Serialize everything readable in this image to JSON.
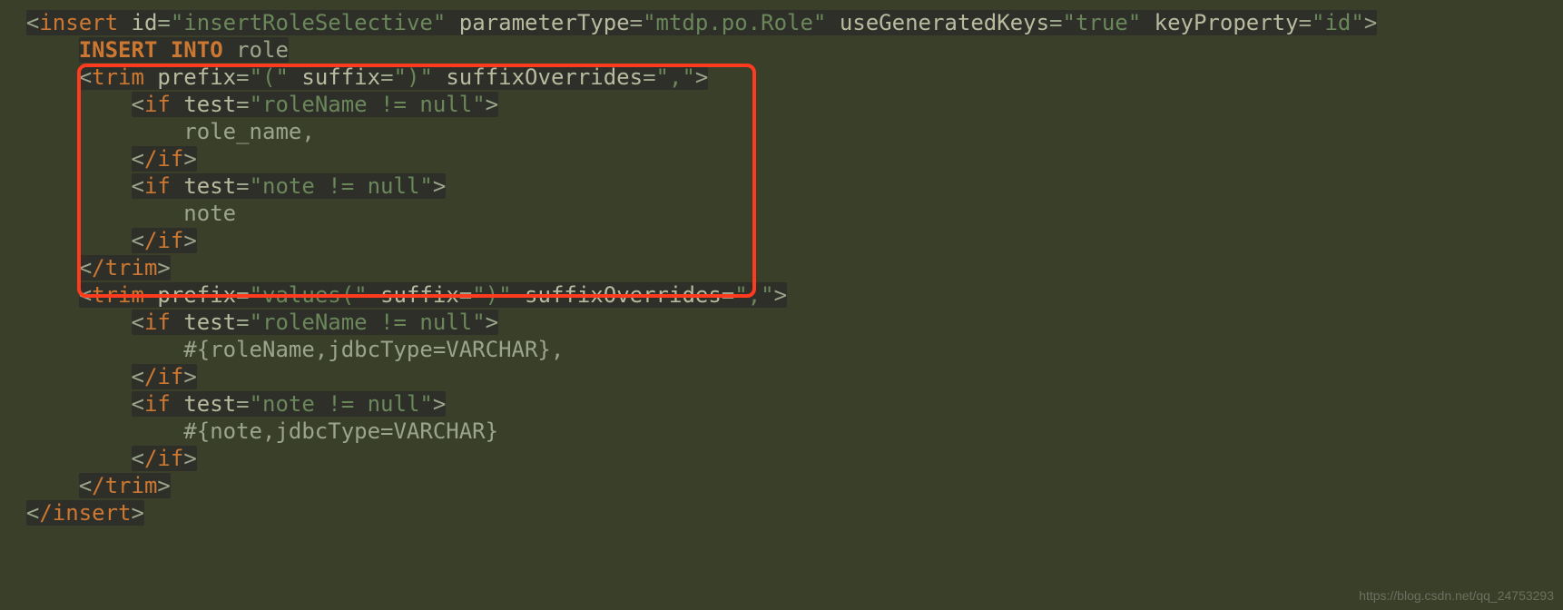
{
  "code": {
    "l1_open_tag": "insert",
    "l1_attr1_name": "id",
    "l1_attr1_val": "insertRoleSelective",
    "l1_attr2_name": "parameterType",
    "l1_attr2_val": "mtdp.po.Role",
    "l1_attr3_name": "useGeneratedKeys",
    "l1_attr3_val": "true",
    "l1_attr4_name": "keyProperty",
    "l1_attr4_val": "id",
    "l2_kw": "INSERT INTO",
    "l2_tbl": "role",
    "trim1_tag": "trim",
    "trim1_at1n": "prefix",
    "trim1_at1v": "(",
    "trim1_at2n": "suffix",
    "trim1_at2v": ")",
    "trim1_at3n": "suffixOverrides",
    "trim1_at3v": ",",
    "if1_tag": "if",
    "if1_atn": "test",
    "if1_atv": "roleName != null",
    "if1_body": "role_name,",
    "if1_close": "/if",
    "if2_tag": "if",
    "if2_atn": "test",
    "if2_atv": "note != null",
    "if2_body": "note",
    "if2_close": "/if",
    "trim1_close": "/trim",
    "trim2_tag": "trim",
    "trim2_at1n": "prefix",
    "trim2_at1v": "values(",
    "trim2_at2n": "suffix",
    "trim2_at2v": ")",
    "trim2_at3n": "suffixOverrides",
    "trim2_at3v": ",",
    "if3_tag": "if",
    "if3_atn": "test",
    "if3_atv": "roleName != null",
    "if3_body": "#{roleName,jdbcType=VARCHAR},",
    "if3_close": "/if",
    "if4_tag": "if",
    "if4_atn": "test",
    "if4_atv": "note != null",
    "if4_body": "#{note,jdbcType=VARCHAR}",
    "if4_close": "/if",
    "trim2_close": "/trim",
    "insert_close": "/insert"
  },
  "watermark": "https://blog.csdn.net/qq_24753293"
}
